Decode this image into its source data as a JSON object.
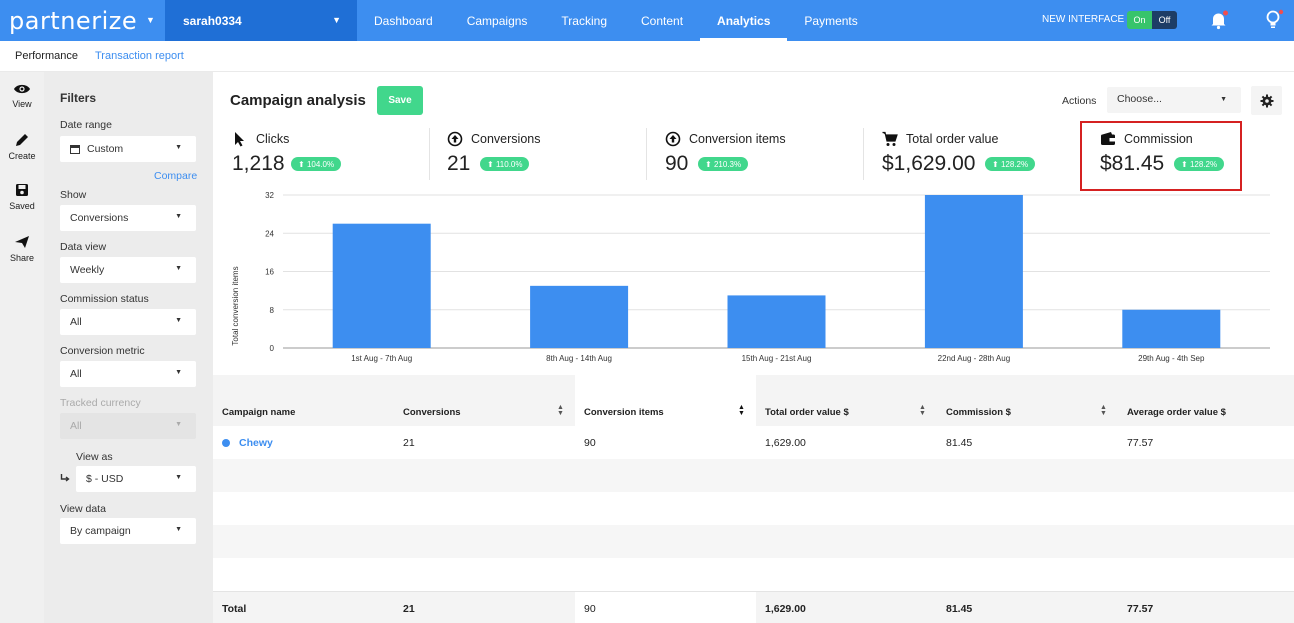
{
  "brand": {
    "name": "partnerize"
  },
  "account": {
    "name": "sarah0334"
  },
  "nav": {
    "items": [
      "Dashboard",
      "Campaigns",
      "Tracking",
      "Content",
      "Analytics",
      "Payments"
    ],
    "active": "Analytics"
  },
  "new_interface": {
    "label": "NEW INTERFACE",
    "on": "On",
    "off": "Off"
  },
  "subnav": {
    "performance": "Performance",
    "transaction_report": "Transaction report"
  },
  "rail": {
    "view": "View",
    "create": "Create",
    "saved": "Saved",
    "share": "Share"
  },
  "filters": {
    "title": "Filters",
    "date_range_label": "Date range",
    "date_range_value": "Custom",
    "compare": "Compare",
    "show_label": "Show",
    "show_value": "Conversions",
    "data_view_label": "Data view",
    "data_view_value": "Weekly",
    "commission_status_label": "Commission status",
    "commission_status_value": "All",
    "conversion_metric_label": "Conversion metric",
    "conversion_metric_value": "All",
    "tracked_currency_label": "Tracked currency",
    "tracked_currency_value": "All",
    "view_as_label": "View as",
    "view_as_value": "$ - USD",
    "view_data_label": "View data",
    "view_data_value": "By campaign"
  },
  "header": {
    "title": "Campaign analysis",
    "save": "Save",
    "actions_label": "Actions",
    "actions_value": "Choose..."
  },
  "metrics": [
    {
      "label": "Clicks",
      "value": "1,218",
      "change": "104.0%"
    },
    {
      "label": "Conversions",
      "value": "21",
      "change": "110.0%"
    },
    {
      "label": "Conversion items",
      "value": "90",
      "change": "210.3%"
    },
    {
      "label": "Total order value",
      "value": "$1,629.00",
      "change": "128.2%"
    },
    {
      "label": "Commission",
      "value": "$81.45",
      "change": "128.2%"
    }
  ],
  "chart_data": {
    "type": "bar",
    "ylabel": "Total conversion items",
    "categories": [
      "1st Aug - 7th Aug",
      "8th Aug - 14th Aug",
      "15th Aug - 21st Aug",
      "22nd Aug - 28th Aug",
      "29th Aug - 4th Sep"
    ],
    "values": [
      26,
      13,
      11,
      32,
      8
    ],
    "yticks": [
      0,
      8,
      16,
      24,
      32
    ],
    "ylim": [
      0,
      32
    ],
    "grid": true,
    "color": "#3d8ef0"
  },
  "table": {
    "headers": [
      "Campaign name",
      "Conversions",
      "Conversion items",
      "Total order value $",
      "Commission $",
      "Average order value $"
    ],
    "rows": [
      [
        "Chewy",
        "21",
        "90",
        "1,629.00",
        "81.45",
        "77.57"
      ]
    ],
    "footer": [
      "Total",
      "21",
      "90",
      "1,629.00",
      "81.45",
      "77.57"
    ]
  }
}
